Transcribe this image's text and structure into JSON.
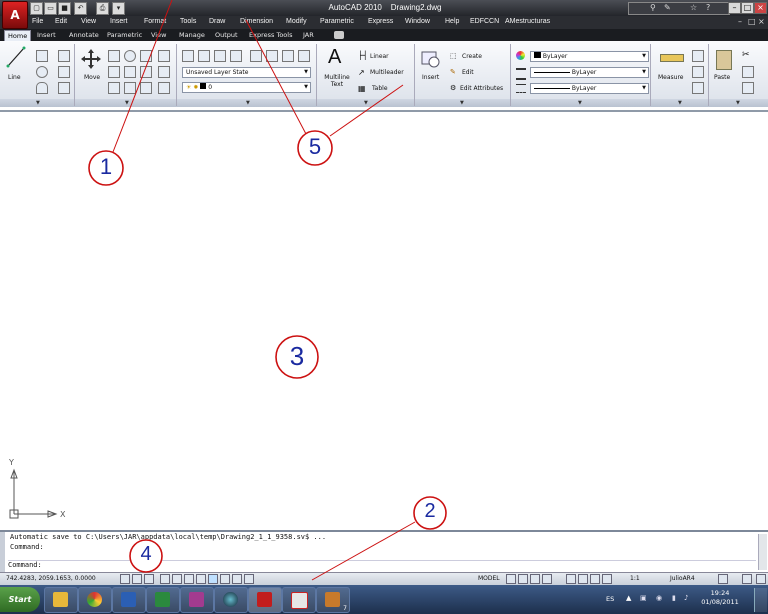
{
  "title_bar": {
    "app_title": "AutoCAD 2010",
    "file_name": "Drawing2.dwg",
    "logo_glyph": "A",
    "window_buttons": [
      "–",
      "□",
      "×"
    ]
  },
  "menu": [
    "File",
    "Edit",
    "View",
    "Insert",
    "Format",
    "Tools",
    "Draw",
    "Dimension",
    "Modify",
    "Parametric",
    "Express",
    "Window",
    "Help",
    "EDFCCN",
    "AMestructuras"
  ],
  "tabs": [
    "Home",
    "Insert",
    "Annotate",
    "Parametric",
    "View",
    "Manage",
    "Output",
    "Express Tools",
    "JAR"
  ],
  "ribbon": {
    "draw": {
      "line_label": "Line"
    },
    "modify": {
      "move_label": "Move"
    },
    "layers": {
      "layer_state": "Unsaved Layer State",
      "current_layer": "0"
    },
    "annotation": {
      "multiline_text_label": "Multiline Text",
      "text_glyph": "A",
      "linear_label": "Linear",
      "multileader_label": "Multileader",
      "table_label": "Table"
    },
    "block": {
      "insert_label": "Insert",
      "create_label": "Create",
      "edit_label": "Edit",
      "edit_attributes_label": "Edit Attributes"
    },
    "properties": {
      "color": "ByLayer",
      "linetype": "ByLayer",
      "lineweight": "ByLayer"
    },
    "utilities": {
      "measure_label": "Measure"
    },
    "clipboard": {
      "paste_label": "Paste"
    }
  },
  "callouts": [
    "1",
    "2",
    "3",
    "4",
    "5"
  ],
  "ucs": {
    "y": "Y",
    "x": "X"
  },
  "command_window": {
    "line1": "Automatic save to C:\\Users\\JAR\\appdata\\local\\temp\\Drawing2_1_1_9358.sv$ ...",
    "line2": "Command:",
    "prompt": "Command:"
  },
  "status_bar": {
    "coordinates": "742.4283, 2059.1653, 0.0000",
    "model_label": "MODEL",
    "annotation_scale": "1:1",
    "workspace": "JulioAR4"
  },
  "taskbar": {
    "start_label": "Start",
    "language": "ES",
    "time": "19:24",
    "date": "01/08/2011",
    "badge": "7"
  },
  "colors": {
    "callout_red": "#cc1111",
    "callout_text": "#1a2aa0",
    "title_bg": "#2a2c31"
  }
}
